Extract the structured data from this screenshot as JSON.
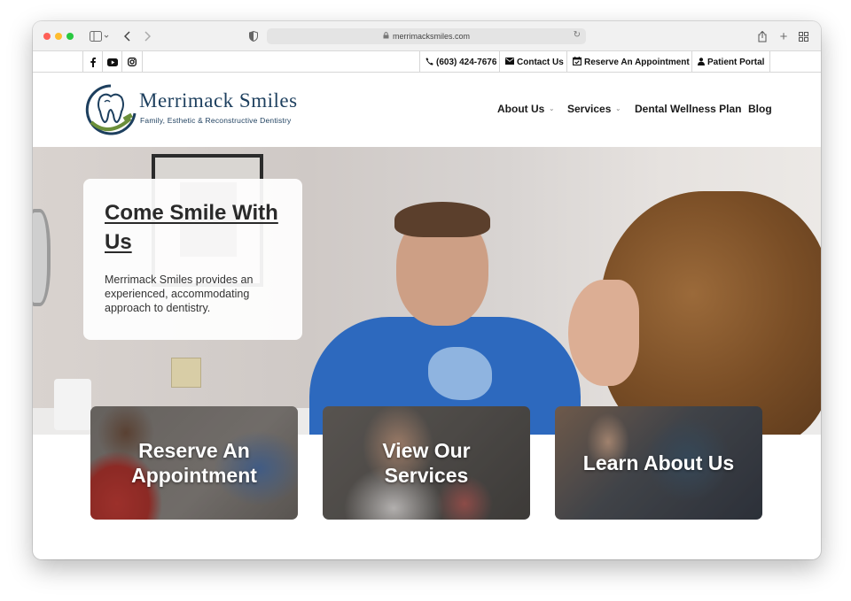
{
  "browser": {
    "url": "merrimacksmiles.com"
  },
  "topbar": {
    "social": [
      {
        "name": "facebook",
        "glyph": "f"
      },
      {
        "name": "youtube",
        "glyph": "▶"
      },
      {
        "name": "instagram",
        "glyph": "◎"
      }
    ],
    "phone": "(603) 424-7676",
    "contact": "Contact Us",
    "reserve": "Reserve An Appointment",
    "portal": "Patient Portal"
  },
  "logo": {
    "name": "Merrimack Smiles",
    "tagline": "Family, Esthetic & Reconstructive Dentistry"
  },
  "nav": {
    "items": [
      {
        "label": "About Us",
        "has_dropdown": true
      },
      {
        "label": "Services",
        "has_dropdown": true
      },
      {
        "label": "Dental Wellness Plan",
        "has_dropdown": false
      },
      {
        "label": "Blog",
        "has_dropdown": false
      }
    ]
  },
  "hero": {
    "title": "Come Smile With Us",
    "text": "Merrimack Smiles provides an experienced, accommodating approach to dentistry."
  },
  "cta": [
    {
      "label": "Reserve An Appointment"
    },
    {
      "label": "View Our Services"
    },
    {
      "label": "Learn About Us"
    }
  ],
  "colors": {
    "brand_navy": "#1d3f5e",
    "accent_green": "#6b8f3a",
    "text_dark": "#1a1a1a"
  }
}
